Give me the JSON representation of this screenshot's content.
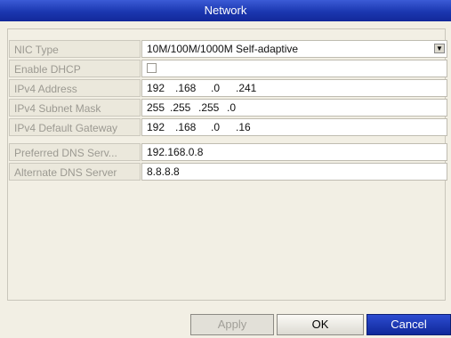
{
  "window": {
    "title": "Network"
  },
  "fields": [
    {
      "label": "NIC Type",
      "value": "10M/100M/1000M Self-adaptive",
      "kind": "dropdown",
      "icon": "chevron-down-icon"
    },
    {
      "label": "Enable DHCP",
      "checked": false,
      "kind": "checkbox"
    },
    {
      "label": "IPv4 Address",
      "segments": [
        "192",
        ".168",
        ".0",
        ".241"
      ],
      "kind": "ip"
    },
    {
      "label": "IPv4 Subnet Mask",
      "segments": [
        "255",
        ".255",
        ".255",
        ".0"
      ],
      "kind": "ip"
    },
    {
      "label": "IPv4 Default Gateway",
      "segments": [
        "192",
        ".168",
        ".0",
        ".16"
      ],
      "kind": "ip"
    }
  ],
  "dns": [
    {
      "label": "Preferred DNS Serv...",
      "value": "192.168.0.8"
    },
    {
      "label": "Alternate DNS Server",
      "value": "8.8.8.8"
    }
  ],
  "buttons": {
    "apply": "Apply",
    "ok": "OK",
    "cancel": "Cancel"
  },
  "colors": {
    "titlebar": "#1b37b0",
    "cancel": "#10289a",
    "background": "#f2efe4"
  }
}
